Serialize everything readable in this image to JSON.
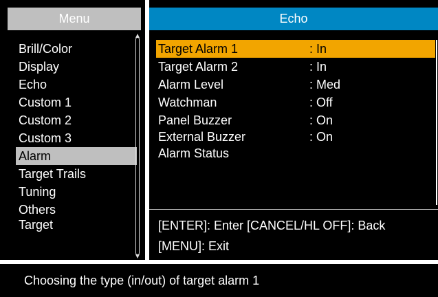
{
  "menu": {
    "title": "Menu",
    "items": [
      {
        "label": "Brill/Color"
      },
      {
        "label": "Display"
      },
      {
        "label": "Echo"
      },
      {
        "label": "Custom 1"
      },
      {
        "label": "Custom 2"
      },
      {
        "label": "Custom 3"
      },
      {
        "label": "Alarm",
        "selected": true
      },
      {
        "label": "Target Trails"
      },
      {
        "label": "Tuning"
      },
      {
        "label": "Others"
      },
      {
        "label": "Target"
      }
    ]
  },
  "echo": {
    "title": "Echo",
    "rows": [
      {
        "label": "Target Alarm 1",
        "value": ": In",
        "selected": true
      },
      {
        "label": "Target Alarm 2",
        "value": ": In"
      },
      {
        "label": "Alarm Level",
        "value": ": Med"
      },
      {
        "label": "Watchman",
        "value": ": Off"
      },
      {
        "label": "Panel Buzzer",
        "value": ": On"
      },
      {
        "label": "External Buzzer",
        "value": ": On"
      },
      {
        "label": "Alarm Status",
        "value": ""
      }
    ],
    "help_line1": "[ENTER]: Enter [CANCEL/HL OFF]: Back",
    "help_line2": "[MENU]: Exit"
  },
  "status": {
    "text": "Choosing the type (in/out) of target alarm 1"
  },
  "colors": {
    "menu_title_bg": "#bfbfbf",
    "echo_title_bg": "#0087c3",
    "selected_row_bg": "#f2a500"
  }
}
